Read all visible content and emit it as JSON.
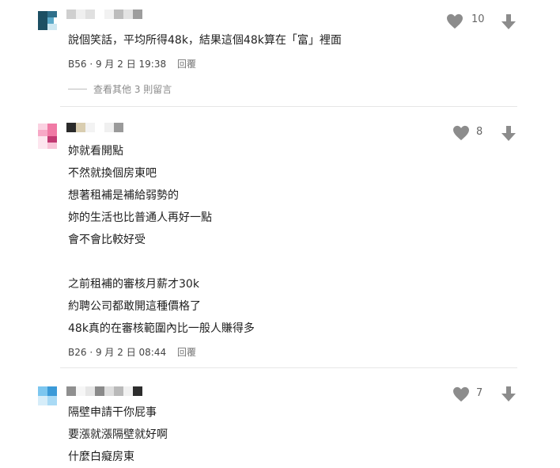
{
  "comments": [
    {
      "text": "說個笑話，平均所得48k，結果這個48k算在「富」裡面",
      "floor": "B56",
      "datetime": "9 月 2 日 19:38",
      "reply_label": "回覆",
      "likes": "10",
      "more_replies": "查看其他 3 則留言"
    },
    {
      "text": "妳就看開點\n不然就換個房東吧\n想著租補是補給弱勢的\n妳的生活也比普通人再好一點\n會不會比較好受\n\n之前租補的審核月薪才30k\n約聘公司都敢開這種價格了\n48k真的在審核範圍內比一般人賺得多",
      "floor": "B26",
      "datetime": "9 月 2 日 08:44",
      "reply_label": "回覆",
      "likes": "8"
    },
    {
      "text": "隔壁申請干你屁事\n要漲就漲隔壁就好啊\n什麼白癡房東",
      "likes": "7"
    }
  ],
  "colors": {
    "icon_gray": "#8c8c8c",
    "avatar1": [
      "#1c4f63",
      "#5ba9c8",
      "#cde7f1"
    ],
    "avatar2": [
      "#f07aa5",
      "#c23a73",
      "#fbd2e2"
    ],
    "avatar3": [
      "#3b9ad8",
      "#7cc6ef",
      "#d6edf9"
    ]
  },
  "icons": [
    "heart-icon",
    "thumbs-down-arrow-icon"
  ]
}
